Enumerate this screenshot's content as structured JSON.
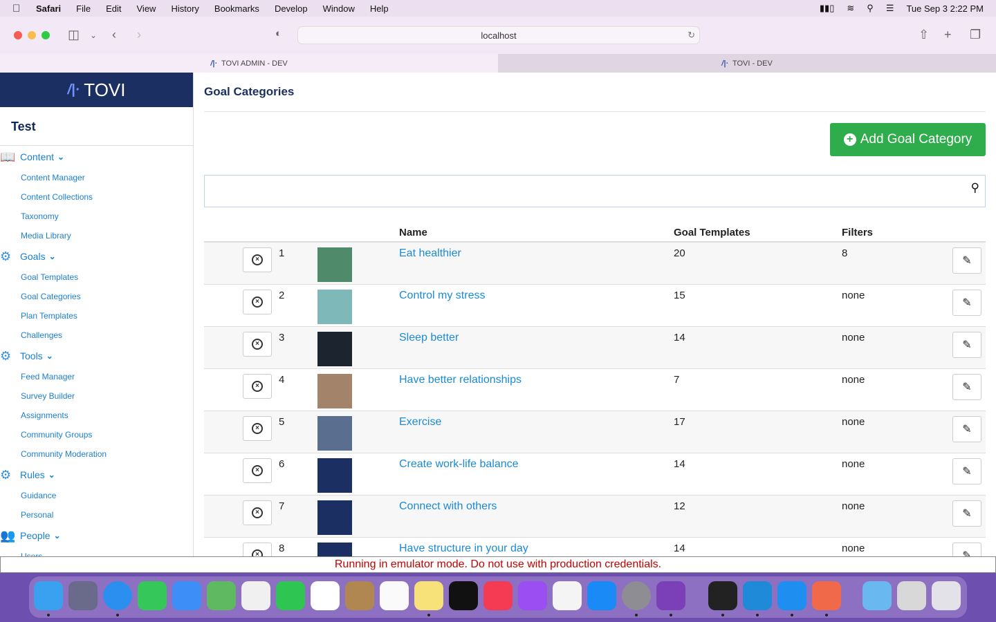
{
  "menubar": {
    "app": "Safari",
    "items": [
      "File",
      "Edit",
      "View",
      "History",
      "Bookmarks",
      "Develop",
      "Window",
      "Help"
    ],
    "datetime": "Tue Sep 3  2:22 PM"
  },
  "browser": {
    "url": "localhost",
    "tabs": [
      {
        "label": "TOVI ADMIN - DEV",
        "active": true
      },
      {
        "label": "TOVI - DEV",
        "active": false
      }
    ]
  },
  "sidebar": {
    "logo": "TOVI",
    "org": "Test",
    "sections": [
      {
        "label": "Content",
        "icon": "book-icon",
        "items": [
          "Content Manager",
          "Content Collections",
          "Taxonomy",
          "Media Library"
        ]
      },
      {
        "label": "Goals",
        "icon": "gear-icon",
        "items": [
          "Goal Templates",
          "Goal Categories",
          "Plan Templates",
          "Challenges"
        ]
      },
      {
        "label": "Tools",
        "icon": "gear-icon",
        "items": [
          "Feed Manager",
          "Survey Builder",
          "Assignments",
          "Community Groups",
          "Community Moderation"
        ]
      },
      {
        "label": "Rules",
        "icon": "gear-icon",
        "items": [
          "Guidance",
          "Personal"
        ]
      },
      {
        "label": "People",
        "icon": "people-icon",
        "items": [
          "Users"
        ]
      }
    ]
  },
  "main": {
    "title": "Goal Categories",
    "add_button": "Add Goal Category",
    "table": {
      "headers": [
        "Name",
        "Goal Templates",
        "Filters"
      ],
      "rows": [
        {
          "num": "1",
          "name": "Eat healthier",
          "templates": "20",
          "filters": "8",
          "thumb": "#4f8a6b"
        },
        {
          "num": "2",
          "name": "Control my stress",
          "templates": "15",
          "filters": "none",
          "thumb": "#7fb8b9"
        },
        {
          "num": "3",
          "name": "Sleep better",
          "templates": "14",
          "filters": "none",
          "thumb": "#1c2430"
        },
        {
          "num": "4",
          "name": "Have better relationships",
          "templates": "7",
          "filters": "none",
          "thumb": "#a3836a"
        },
        {
          "num": "5",
          "name": "Exercise",
          "templates": "17",
          "filters": "none",
          "thumb": "#5a6f8f"
        },
        {
          "num": "6",
          "name": "Create work-life balance",
          "templates": "14",
          "filters": "none",
          "thumb": "#1b2f63"
        },
        {
          "num": "7",
          "name": "Connect with others",
          "templates": "12",
          "filters": "none",
          "thumb": "#1b2f63"
        },
        {
          "num": "8",
          "name": "Have structure in your day",
          "templates": "14",
          "filters": "none",
          "thumb": "#1b2f63"
        }
      ]
    }
  },
  "banner": "Running in emulator mode. Do not use with production credentials.",
  "colors": {
    "brand_navy": "#1b2f63",
    "link_blue": "#1a8ad8",
    "add_green": "#2fad4d",
    "warning_red": "#c40000"
  }
}
